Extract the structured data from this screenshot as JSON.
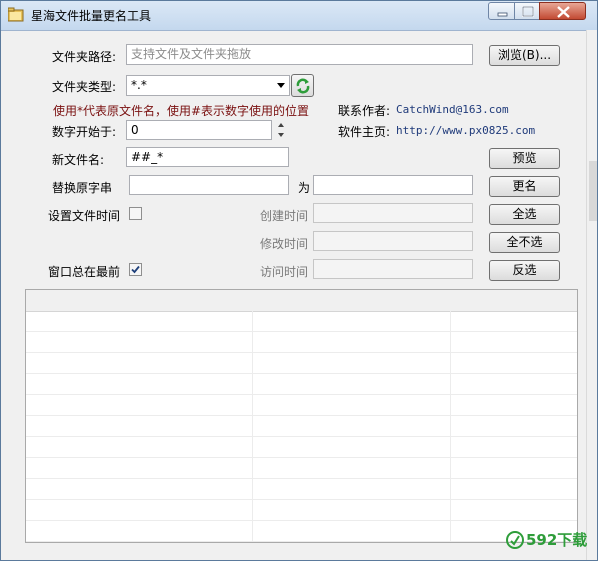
{
  "window": {
    "title": "星海文件批量更名工具",
    "icon": "folder-icon",
    "controls": [
      "minimize-icon",
      "maximize-icon",
      "close-icon"
    ]
  },
  "form": {
    "folder_path_label": "文件夹路径:",
    "folder_path_placeholder": "支持文件及文件夹拖放",
    "browse_button": "浏览(B)...",
    "file_type_label": "文件夹类型:",
    "file_type_value": "*.*",
    "refresh_icon": "refresh-icon",
    "hint": "使用*代表原文件名，使用#表示数字使用的位置",
    "start_number_label": "数字开始于:",
    "start_number_value": "0",
    "new_name_label": "新文件名:",
    "new_name_value": "##_*",
    "replace_label": "替换原字串",
    "replace_with_label": "为",
    "set_time_label": "设置文件时间",
    "created_time_label": "创建时间",
    "modified_time_label": "修改时间",
    "accessed_time_label": "访问时间",
    "always_on_top_label": "窗口总在最前",
    "always_on_top_checked": true,
    "set_time_checked": false
  },
  "info": {
    "contact_label": "联系作者:",
    "contact_value": "CatchWind@163.com",
    "homepage_label": "软件主页:",
    "homepage_value": "http://www.px0825.com"
  },
  "buttons": {
    "preview": "预览",
    "rename": "更名",
    "select_all": "全选",
    "select_none": "全不选",
    "invert": "反选"
  },
  "watermark": {
    "text": "592下载"
  },
  "colors": {
    "hint": "#7a1010",
    "link": "#1f3a7a",
    "watermark": "#2e9d3a"
  }
}
